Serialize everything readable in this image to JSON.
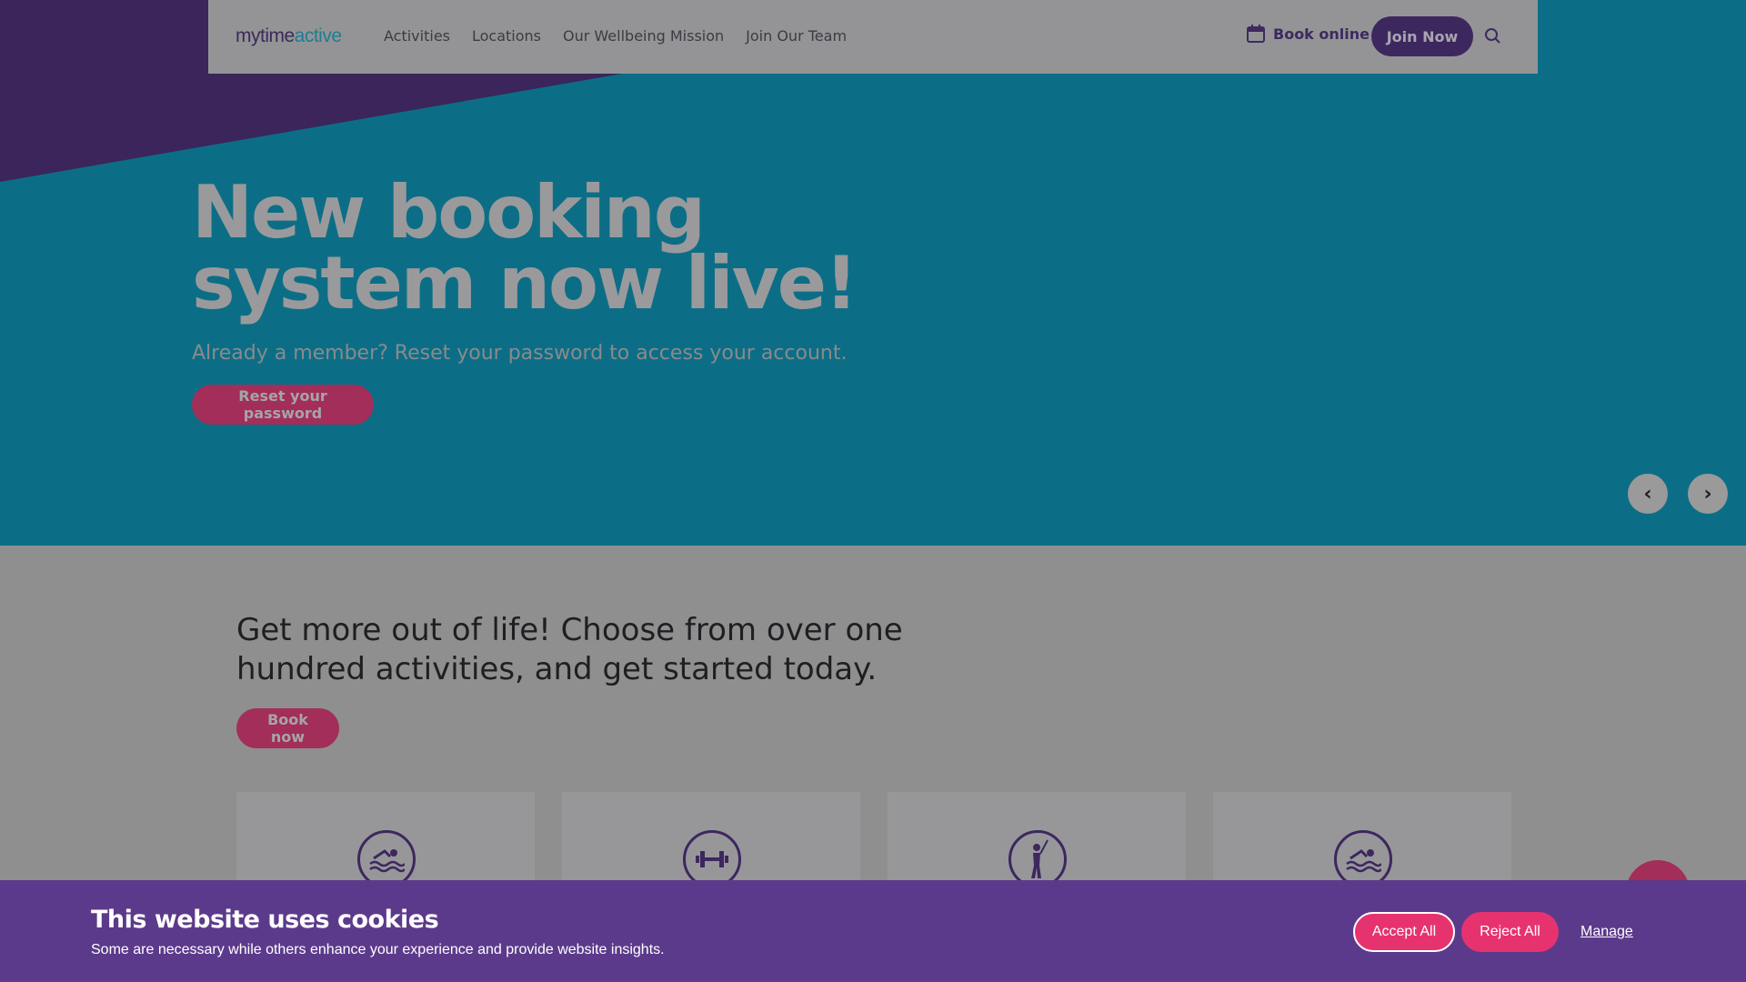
{
  "header": {
    "logo_part1": "mytime",
    "logo_part2": "active",
    "nav": [
      "Activities",
      "Locations",
      "Our Wellbeing Mission",
      "Join Our Team"
    ],
    "book_online": "Book online",
    "join_now": "Join Now"
  },
  "hero": {
    "title": "New booking system now live!",
    "subtitle": "Already a member? Reset your password to access your account.",
    "cta": "Reset your password",
    "prev_arrow": "‹",
    "next_arrow": "›"
  },
  "content": {
    "heading": "Get more out of life! Choose from over one hundred activities, and get started today.",
    "cta": "Book now",
    "cards": [
      {
        "icon": "swimming-icon"
      },
      {
        "icon": "dumbbell-icon"
      },
      {
        "icon": "golf-icon"
      },
      {
        "icon": "swimming-icon"
      }
    ]
  },
  "cookie": {
    "title": "This website uses cookies",
    "text": "Some are necessary while others enhance your experience and provide website insights.",
    "accept": "Accept All",
    "reject": "Reject All",
    "manage": "Manage"
  },
  "colors": {
    "brand_purple": "#3d275f",
    "hero_teal": "#0c6e86",
    "accent_pink": "#e6336f",
    "cookie_purple": "#5c3a8b"
  }
}
